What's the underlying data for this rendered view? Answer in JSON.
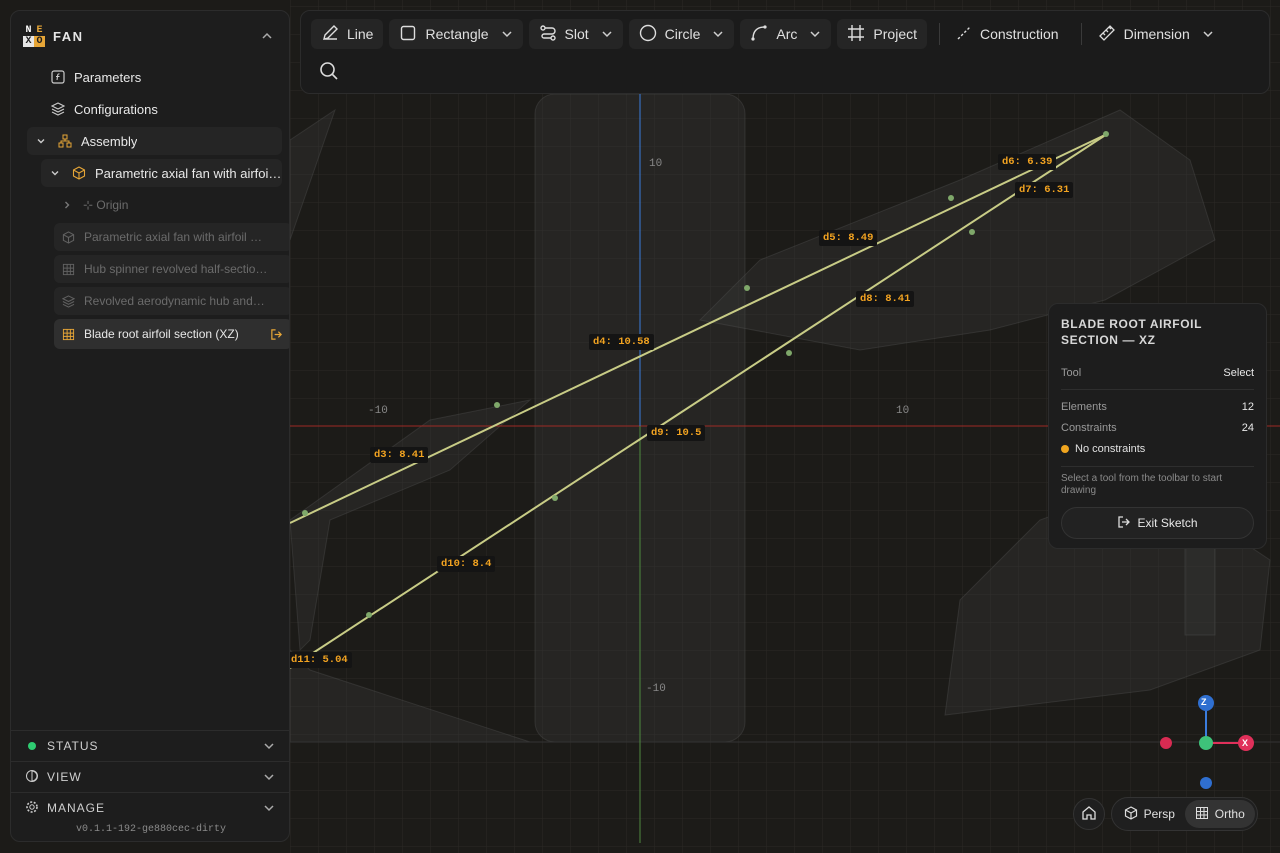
{
  "app": {
    "name": "FAN",
    "logo_letters": [
      "N",
      "E",
      "X",
      "O"
    ]
  },
  "sidebar": {
    "items": [
      {
        "label": "Parameters",
        "icon": "function-icon"
      },
      {
        "label": "Configurations",
        "icon": "layers-icon"
      },
      {
        "label": "Assembly",
        "icon": "hierarchy-icon"
      },
      {
        "label": "Parametric axial fan with airfoil …",
        "icon": "cube-icon"
      },
      {
        "label": "Origin",
        "icon": "origin-icon"
      },
      {
        "label": "Parametric axial fan with airfoil …",
        "icon": "cube-icon"
      },
      {
        "label": "Hub spinner revolved half-sectio…",
        "icon": "grid-icon"
      },
      {
        "label": "Revolved aerodynamic hub and…",
        "icon": "layers-icon"
      },
      {
        "label": "Blade root airfoil section (XZ)",
        "icon": "grid-icon"
      }
    ],
    "sections": [
      {
        "label": "STATUS",
        "icon": "status-dot"
      },
      {
        "label": "VIEW",
        "icon": "view-icon"
      },
      {
        "label": "MANAGE",
        "icon": "gear-icon"
      }
    ],
    "version": "v0.1.1-192-ge880cec-dirty"
  },
  "toolbar": {
    "tools": [
      {
        "label": "Line",
        "icon": "pencil-icon"
      },
      {
        "label": "Rectangle",
        "icon": "rectangle-icon"
      },
      {
        "label": "Slot",
        "icon": "slot-icon"
      },
      {
        "label": "Circle",
        "icon": "circle-icon"
      },
      {
        "label": "Arc",
        "icon": "arc-icon"
      },
      {
        "label": "Project",
        "icon": "project-icon"
      },
      {
        "label": "Construction",
        "icon": "construction-icon"
      },
      {
        "label": "Dimension",
        "icon": "ruler-icon"
      }
    ]
  },
  "viewport": {
    "axis_ticks": {
      "y_top": "10",
      "y_bottom": "-10",
      "x_left": "-10",
      "x_right": "10"
    },
    "dimensions": [
      {
        "label": "d3: 8.41"
      },
      {
        "label": "d4: 10.58"
      },
      {
        "label": "d5: 8.49"
      },
      {
        "label": "d6: 6.39"
      },
      {
        "label": "d7: 6.31"
      },
      {
        "label": "d8: 8.41"
      },
      {
        "label": "d9: 10.5"
      },
      {
        "label": "d10: 8.4"
      },
      {
        "label": "d11: 5.04"
      }
    ],
    "axes_gizmo": {
      "z": "Z",
      "x": "X"
    },
    "colors": {
      "x_axis": "#c0392b",
      "y_axis": "#3b7ddd",
      "z_axis": "#5a9a4a",
      "accent": "#f2a321",
      "sketch": "#c8cc86"
    }
  },
  "panel": {
    "title": "BLADE ROOT AIRFOIL SECTION — XZ",
    "tool_label": "Tool",
    "tool_value": "Select",
    "elements_label": "Elements",
    "elements_value": "12",
    "constraints_label": "Constraints",
    "constraints_value": "24",
    "status": "No constraints",
    "hint": "Select a tool from the toolbar to start drawing",
    "exit_label": "Exit Sketch"
  },
  "view_controls": {
    "persp": "Persp",
    "ortho": "Ortho",
    "active": "Ortho"
  }
}
